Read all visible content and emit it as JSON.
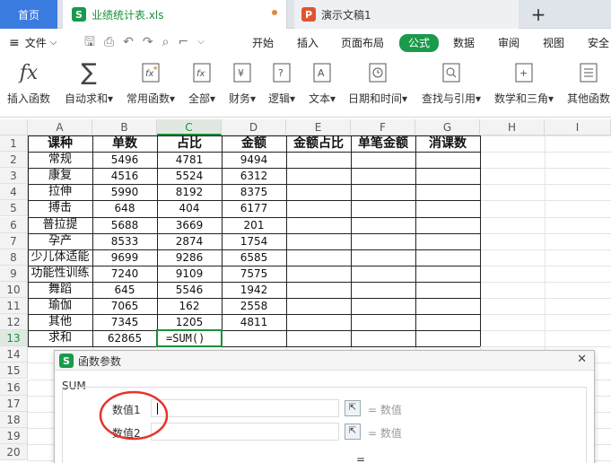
{
  "tabs": {
    "home": "首页",
    "workbook": "业绩统计表.xls",
    "workbook_icon": "S",
    "presentation": "演示文稿1",
    "presentation_icon": "P",
    "new_tab": "+"
  },
  "menu": {
    "file": "文件",
    "items": [
      "开始",
      "插入",
      "页面布局",
      "公式",
      "数据",
      "审阅",
      "视图",
      "安全"
    ],
    "active": "公式"
  },
  "ribbon": [
    {
      "label": "插入函数",
      "icon": "fx-icon"
    },
    {
      "label": "自动求和▾",
      "icon": "sigma-icon"
    },
    {
      "label": "常用函数▾",
      "icon": "star-fx-icon"
    },
    {
      "label": "全部▾",
      "icon": "fx-box-icon"
    },
    {
      "label": "财务▾",
      "icon": "yen-icon"
    },
    {
      "label": "逻辑▾",
      "icon": "question-icon"
    },
    {
      "label": "文本▾",
      "icon": "text-a-icon"
    },
    {
      "label": "日期和时间▾",
      "icon": "clock-icon"
    },
    {
      "label": "查找与引用▾",
      "icon": "magnifier-icon"
    },
    {
      "label": "数学和三角▾",
      "icon": "math-icon"
    },
    {
      "label": "其他函数",
      "icon": "more-icon"
    }
  ],
  "columns": [
    "A",
    "B",
    "C",
    "D",
    "E",
    "F",
    "G",
    "H",
    "I"
  ],
  "selected_column": "C",
  "rows": [
    "1",
    "2",
    "3",
    "4",
    "5",
    "6",
    "7",
    "8",
    "9",
    "10",
    "11",
    "12",
    "13",
    "14",
    "15",
    "16",
    "17",
    "18",
    "19",
    "20"
  ],
  "table": {
    "headers": [
      "课种",
      "单数",
      "占比",
      "金额",
      "金额占比",
      "单笔金额",
      "消课数"
    ],
    "data": [
      [
        "常规",
        "5496",
        "4781",
        "9494"
      ],
      [
        "康复",
        "4516",
        "5524",
        "6312"
      ],
      [
        "拉伸",
        "5990",
        "8192",
        "8375"
      ],
      [
        "搏击",
        "648",
        "404",
        "6177"
      ],
      [
        "普拉提",
        "5688",
        "3669",
        "201"
      ],
      [
        "孕产",
        "8533",
        "2874",
        "1754"
      ],
      [
        "少儿体适能",
        "9699",
        "9286",
        "6585"
      ],
      [
        "功能性训练",
        "7240",
        "9109",
        "7575"
      ],
      [
        "舞蹈",
        "645",
        "5546",
        "1942"
      ],
      [
        "瑜伽",
        "7065",
        "162",
        "2558"
      ],
      [
        "其他",
        "7345",
        "1205",
        "4811"
      ],
      [
        "求和",
        "62865",
        "=SUM()",
        ""
      ]
    ]
  },
  "dialog": {
    "title": "函数参数",
    "function_name": "SUM",
    "args": [
      {
        "label": "数值1",
        "value": "",
        "result": "= 数值"
      },
      {
        "label": "数值2",
        "value": "",
        "result": "= 数值"
      }
    ],
    "total_result": "=",
    "close_label": "✕"
  },
  "annotation_color": "#e8322d"
}
